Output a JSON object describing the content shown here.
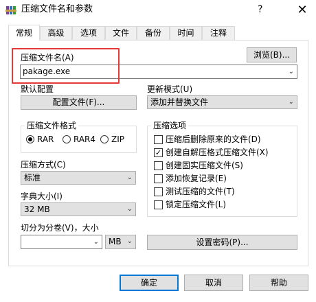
{
  "window": {
    "title": "压缩文件名和参数",
    "help_glyph": "?",
    "close_glyph": "✕"
  },
  "tabs": [
    {
      "label": "常规",
      "active": true
    },
    {
      "label": "高级"
    },
    {
      "label": "选项"
    },
    {
      "label": "文件"
    },
    {
      "label": "备份"
    },
    {
      "label": "时间"
    },
    {
      "label": "注释"
    }
  ],
  "archive_name": {
    "label": "压缩文件名(A)",
    "value": "pakage.exe",
    "browse_label": "浏览(B)..."
  },
  "profile": {
    "label": "默认配置",
    "button_label": "配置文件(F)..."
  },
  "update_mode": {
    "label": "更新模式(U)",
    "value": "添加并替换文件"
  },
  "format": {
    "label": "压缩文件格式",
    "options": [
      {
        "label": "RAR",
        "selected": true
      },
      {
        "label": "RAR4",
        "selected": false
      },
      {
        "label": "ZIP",
        "selected": false
      }
    ]
  },
  "method": {
    "label": "压缩方式(C)",
    "value": "标准"
  },
  "dictionary": {
    "label": "字典大小(I)",
    "value": "32 MB"
  },
  "split": {
    "label": "切分为分卷(V)，大小",
    "value": "",
    "unit": "MB"
  },
  "options": {
    "label": "压缩选项",
    "items": [
      {
        "label": "压缩后删除原来的文件(D)",
        "checked": false
      },
      {
        "label": "创建自解压格式压缩文件(X)",
        "checked": true
      },
      {
        "label": "创建固实压缩文件(S)",
        "checked": false
      },
      {
        "label": "添加恢复记录(E)",
        "checked": false
      },
      {
        "label": "测试压缩的文件(T)",
        "checked": false
      },
      {
        "label": "锁定压缩文件(L)",
        "checked": false
      }
    ]
  },
  "password_button": "设置密码(P)...",
  "buttons": {
    "ok": "确定",
    "cancel": "取消",
    "help": "帮助"
  },
  "colors": {
    "highlight_box": "#e53935",
    "default_button_border": "#0078d7"
  },
  "icons": {
    "app": "winrar-books-icon",
    "checkmark": "✓",
    "dropdown": "chevron-down-icon"
  }
}
